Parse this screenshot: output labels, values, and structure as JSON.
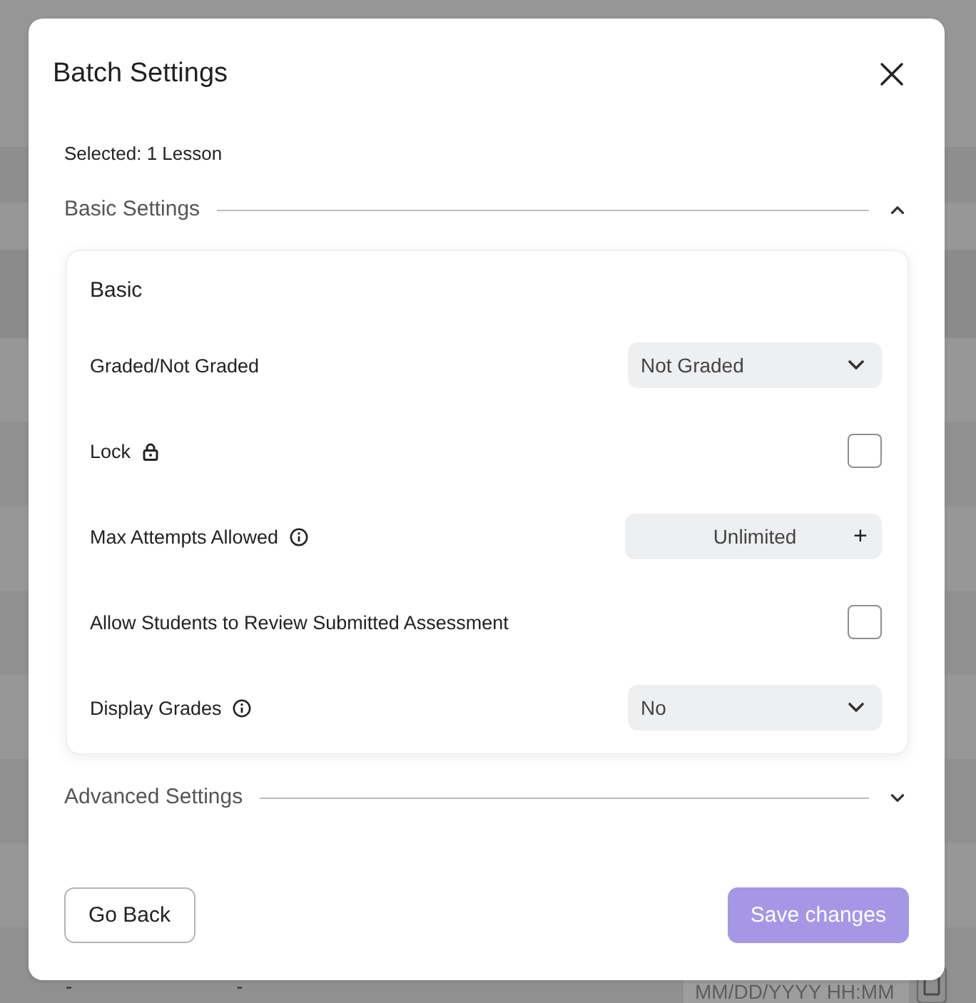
{
  "background_table": {
    "last_row": {
      "column_1": "-",
      "column_2": "-",
      "date_field": {
        "placeholder": "MM/DD/YYYY HH:MM"
      }
    }
  },
  "dialog": {
    "title": "Batch Settings",
    "selection_summary": "Selected: 1 Lesson",
    "sections": [
      {
        "title": "Basic Settings",
        "expanded": true,
        "groups": [
          {
            "title": "Basic",
            "settings": [
              {
                "kind": "select",
                "label": "Graded/Not Graded",
                "value": "Not Graded"
              },
              {
                "kind": "checkbox",
                "label": "Lock",
                "lock_marker": true,
                "checked": false
              },
              {
                "kind": "stepper",
                "label": "Max Attempts Allowed",
                "tooltip": true,
                "value": "Unlimited",
                "step_button": "+"
              },
              {
                "kind": "checkbox",
                "label": "Allow Students to Review Submitted Assessment",
                "checked": false
              },
              {
                "kind": "select",
                "label": "Display Grades",
                "tooltip": true,
                "value": "No"
              }
            ]
          }
        ]
      },
      {
        "title": "Advanced Settings",
        "expanded": false
      }
    ],
    "buttons": [
      {
        "label": "Go Back",
        "kind": "secondary",
        "disabled": false
      },
      {
        "label": "Save changes",
        "kind": "primary",
        "disabled": true
      }
    ]
  }
}
